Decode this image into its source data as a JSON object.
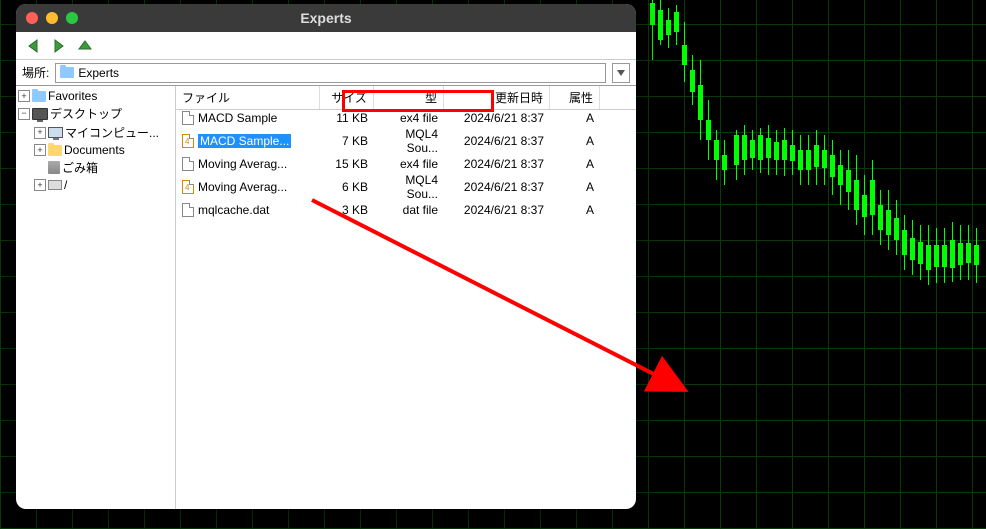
{
  "window": {
    "title": "Experts"
  },
  "location": {
    "label": "場所:",
    "value": "Experts"
  },
  "tree": {
    "favorites": "Favorites",
    "desktop": "デスクトップ",
    "mycomputer": "マイコンピュー...",
    "documents": "Documents",
    "trash": "ごみ箱",
    "drive": "/"
  },
  "columns": {
    "filename": "ファイル",
    "size": "サイズ",
    "type": "型",
    "modified": "更新日時",
    "attr": "属性"
  },
  "files": [
    {
      "name": "MACD Sample",
      "size": "11 KB",
      "type": "ex4 file",
      "date": "2024/6/21 8:37",
      "attr": "A",
      "icon": "file"
    },
    {
      "name": "MACD Sample...",
      "size": "7 KB",
      "type": "MQL4 Sou...",
      "date": "2024/6/21 8:37",
      "attr": "A",
      "icon": "mq4",
      "selected": true
    },
    {
      "name": "Moving Averag...",
      "size": "15 KB",
      "type": "ex4 file",
      "date": "2024/6/21 8:37",
      "attr": "A",
      "icon": "file"
    },
    {
      "name": "Moving Averag...",
      "size": "6 KB",
      "type": "MQL4 Sou...",
      "date": "2024/6/21 8:37",
      "attr": "A",
      "icon": "mq4"
    },
    {
      "name": "mqlcache.dat",
      "size": "3 KB",
      "type": "dat file",
      "date": "2024/6/21 8:37",
      "attr": "A",
      "icon": "file"
    }
  ]
}
